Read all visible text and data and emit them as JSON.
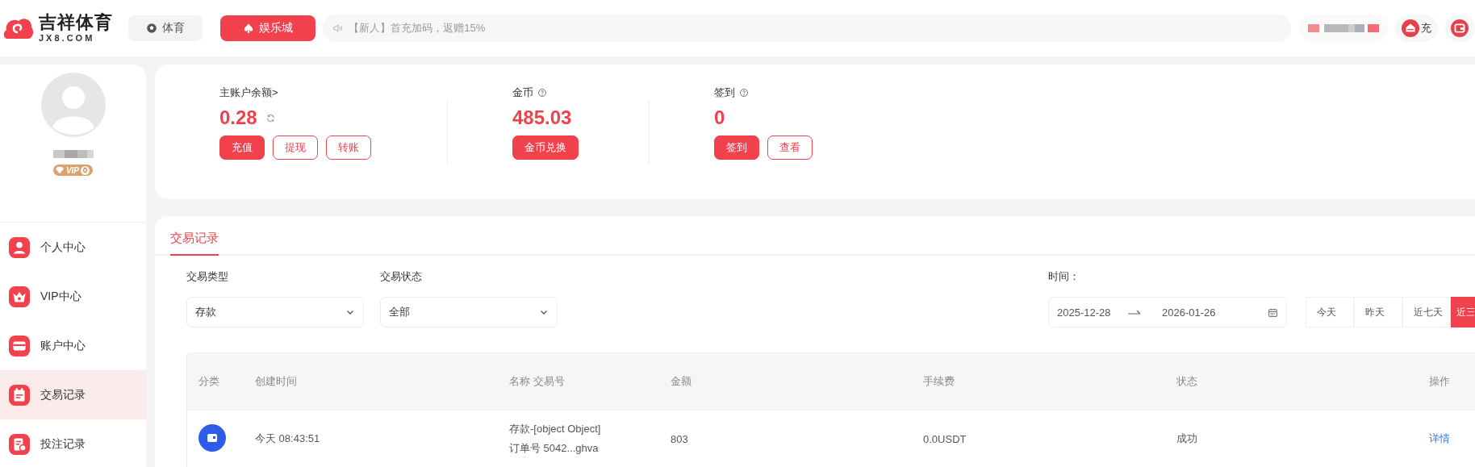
{
  "header": {
    "logo": {
      "name": "吉祥体育",
      "domain": "JX8.COM"
    },
    "nav": [
      {
        "label": "体育",
        "kind": "ball",
        "selected": false
      },
      {
        "label": "娱乐城",
        "kind": "spade",
        "selected": true
      }
    ],
    "notice": "【新人】首充加码，返赠15%",
    "actions": [
      {
        "label": "充",
        "kind": "deposit"
      },
      {
        "kind": "wallet"
      }
    ]
  },
  "profile": {
    "vip": {
      "label": "VIP",
      "level": "0"
    }
  },
  "sidebar": {
    "items": [
      {
        "label": "个人中心",
        "kind": "user",
        "selected": false
      },
      {
        "label": "VIP中心",
        "kind": "crown",
        "selected": false
      },
      {
        "label": "账户中心",
        "kind": "card",
        "selected": false
      },
      {
        "label": "交易记录",
        "kind": "calendar",
        "selected": true
      },
      {
        "label": "投注记录",
        "kind": "receipt",
        "selected": false
      }
    ]
  },
  "summary": [
    {
      "label": "主账户余额>",
      "help": false,
      "refresh": true,
      "value": "0.28",
      "buttons": [
        {
          "label": "充值",
          "kind": "primary"
        },
        {
          "label": "提现",
          "kind": "outline"
        },
        {
          "label": "转账",
          "kind": "outline"
        }
      ]
    },
    {
      "label": "金币",
      "help": true,
      "refresh": false,
      "value": "485.03",
      "buttons": [
        {
          "label": "金币兑换",
          "kind": "primary"
        }
      ]
    },
    {
      "label": "签到",
      "help": true,
      "refresh": false,
      "value": "0",
      "buttons": [
        {
          "label": "签到",
          "kind": "primary"
        },
        {
          "label": "查看",
          "kind": "outline"
        }
      ]
    }
  ],
  "tabs": [
    {
      "label": "交易记录",
      "selected": true
    }
  ],
  "filters": [
    {
      "label": "交易类型",
      "value": "存款"
    },
    {
      "label": "交易状态",
      "value": "全部"
    }
  ],
  "time": {
    "label": "时间：",
    "start": "2025-12-28",
    "end": "2026-01-26"
  },
  "quick_ranges": [
    {
      "label": "今天",
      "selected": false
    },
    {
      "label": "昨天",
      "selected": false
    },
    {
      "label": "近七天",
      "selected": false
    },
    {
      "label": "近三",
      "selected": true
    }
  ],
  "table": {
    "columns": [
      "分类",
      "创建时间",
      "名称 交易号",
      "金额",
      "手续费",
      "状态",
      "操作"
    ],
    "rows": [
      {
        "kind": "wallet",
        "time": "今天 08:43:51",
        "name": "存款-[object Object]",
        "order": "订单号 5042...ghva",
        "amount": "803",
        "fee": "0.0USDT",
        "status": "成功",
        "action": "详情"
      }
    ]
  }
}
